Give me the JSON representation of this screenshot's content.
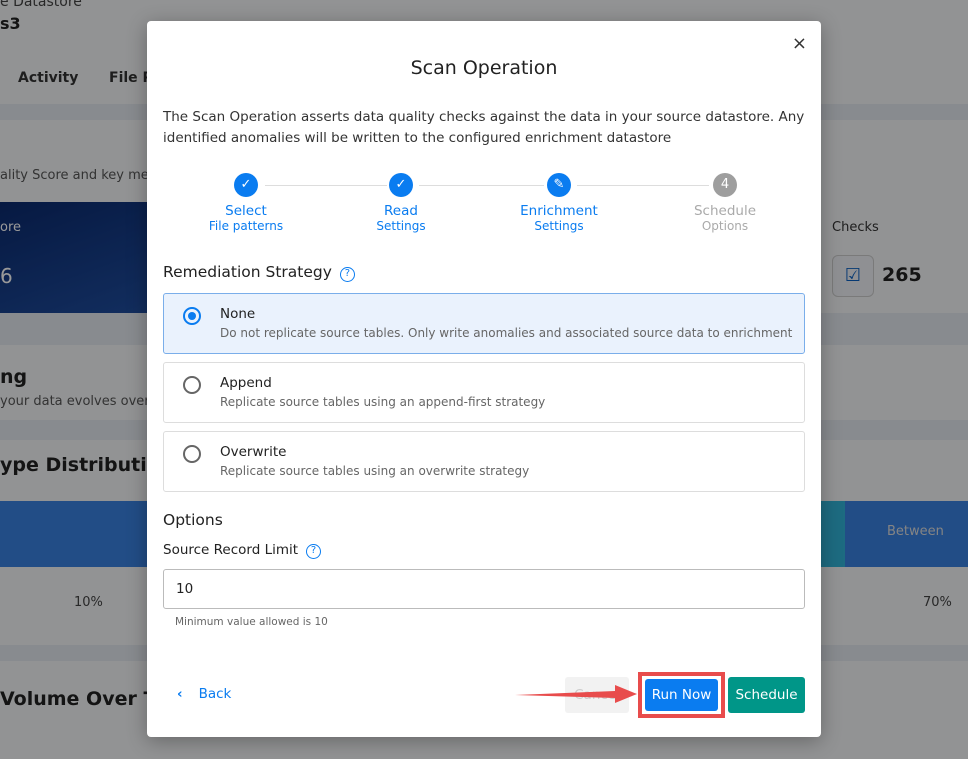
{
  "background": {
    "datastore_label": "e Datastore",
    "datastore_name": "s3",
    "tabs": [
      "Activity",
      "File Pa"
    ],
    "subtitle": "ality Score and key met",
    "score_label": "ore",
    "score_value": "6",
    "checks_label": "Checks",
    "checks_value": "265",
    "section1": "ng",
    "section1_desc": " your data evolves over",
    "section2": "ype Distribution",
    "bar_label": "Between",
    "pct_left": "10%",
    "pct_right": "70%",
    "section3": "Volume Over Tim"
  },
  "modal": {
    "title": "Scan Operation",
    "close": "×",
    "description": "The Scan Operation asserts data quality checks against the data in your source datastore. Any identified anomalies will be written to the configured enrichment datastore",
    "steps": [
      {
        "icon": "check-icon",
        "glyph": "✓",
        "title": "Select",
        "sub": "File patterns"
      },
      {
        "icon": "check-icon",
        "glyph": "✓",
        "title": "Read",
        "sub": "Settings"
      },
      {
        "icon": "pencil-icon",
        "glyph": "✎",
        "title": "Enrichment",
        "sub": "Settings"
      },
      {
        "glyph": "4",
        "title": "Schedule",
        "sub": "Options"
      }
    ],
    "remediation_title": "Remediation Strategy",
    "options": [
      {
        "name": "None",
        "desc": "Do not replicate source tables. Only write anomalies and associated source data to enrichment",
        "selected": true
      },
      {
        "name": "Append",
        "desc": "Replicate source tables using an append-first strategy",
        "selected": false
      },
      {
        "name": "Overwrite",
        "desc": "Replicate source tables using an overwrite strategy",
        "selected": false
      }
    ],
    "options_title": "Options",
    "record_limit_label": "Source Record Limit",
    "record_limit_value": "10",
    "record_limit_hint": "Minimum value allowed is 10",
    "back": "Back",
    "cancel": "Cancel",
    "run_now": "Run Now",
    "schedule": "Schedule"
  },
  "colors": {
    "primary": "#0a7cf0",
    "schedule": "#009688",
    "highlight": "#e84c4c"
  }
}
